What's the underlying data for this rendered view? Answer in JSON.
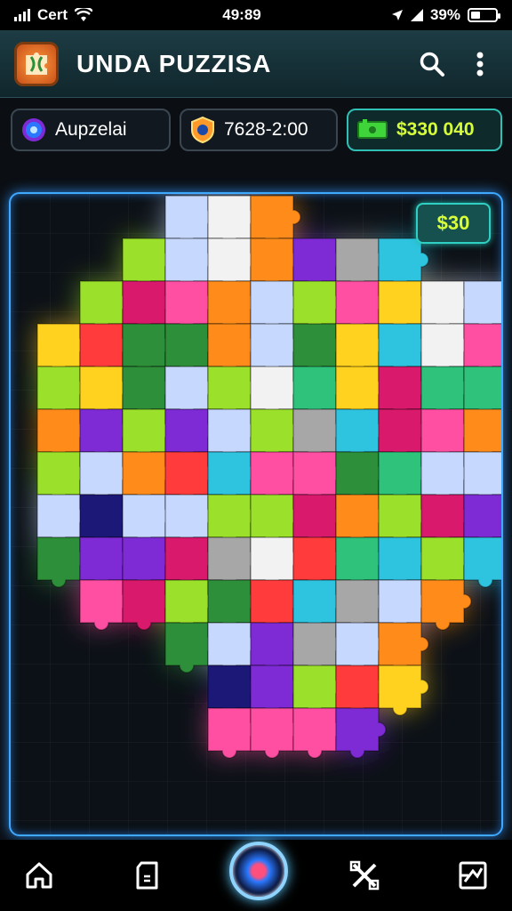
{
  "status_bar": {
    "carrier": "Cert",
    "time": "49:89",
    "battery": "39%",
    "battery_level": 0.39
  },
  "app": {
    "title": "UNDA PUZZISA",
    "logo_icon": "puzzle-logo-icon",
    "search_icon": "search-icon",
    "menu_icon": "more-vert-icon"
  },
  "stats": {
    "username": "Aupzelai",
    "timer": "7628-2:00",
    "cash": "$330 040"
  },
  "board": {
    "reward": "$30"
  },
  "bottom_nav": {
    "items": [
      "home-icon",
      "pieces-icon",
      "play-icon",
      "shuffle-icon",
      "hint-icon"
    ]
  },
  "colors": {
    "accent": "#3fa8ff",
    "cash": "#d6ff3a",
    "puzzle_palette": [
      "#ff3b3b",
      "#ff8c1a",
      "#ffd21f",
      "#9be02a",
      "#2fc27a",
      "#2ec4e0",
      "#c7d8ff",
      "#f2f2f2",
      "#a7a7a7",
      "#ff4fa3",
      "#d9196c",
      "#1b1878",
      "#7e2bd6",
      "#2e8f3a"
    ]
  }
}
